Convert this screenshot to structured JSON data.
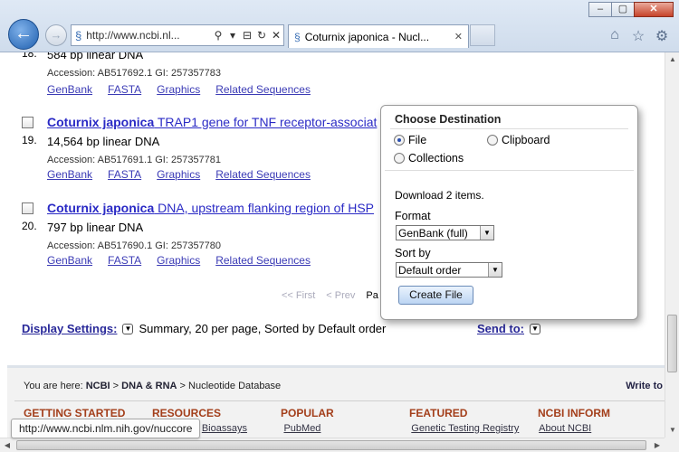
{
  "window": {
    "min": "‒",
    "max": "▢",
    "close": "✕"
  },
  "nav": {
    "back_icon": "arrow-left-icon",
    "forward_icon": "arrow-right-icon"
  },
  "address": {
    "url": "http://www.ncbi.nl...",
    "search_tool": "⚲",
    "dropdown": "▾",
    "compat": "⊟",
    "refresh": "↻",
    "stop": "✕"
  },
  "tab": {
    "title": "Coturnix japonica - Nucl...",
    "close": "✕"
  },
  "toolbar_icons": {
    "home": "⌂",
    "favorites": "☆",
    "tools": "⚙"
  },
  "results": [
    {
      "num": "18.",
      "title_bold": "",
      "title_rest": "",
      "size": "584 bp linear DNA",
      "accession": "Accession: AB517692.1   GI: 257357783",
      "links": [
        "GenBank",
        "FASTA",
        "Graphics",
        "Related Sequences"
      ]
    },
    {
      "num": "19.",
      "title_bold": "Coturnix japonica",
      "title_rest": " TRAP1 gene for TNF receptor-associat",
      "size": "14,564 bp linear DNA",
      "accession": "Accession: AB517691.1   GI: 257357781",
      "links": [
        "GenBank",
        "FASTA",
        "Graphics",
        "Related Sequences"
      ]
    },
    {
      "num": "20.",
      "title_bold": "Coturnix japonica",
      "title_rest": " DNA, upstream flanking region of HSP",
      "size": "797 bp linear DNA",
      "accession": "Accession: AB517690.1   GI: 257357780",
      "links": [
        "GenBank",
        "FASTA",
        "Graphics",
        "Related Sequences"
      ]
    }
  ],
  "pager": {
    "first": "<< First",
    "prev": "< Prev",
    "page": "Pa"
  },
  "display": {
    "label": "Display Settings:",
    "summary": "Summary, 20 per page, Sorted by Default order",
    "send_to": "Send to:"
  },
  "footer": {
    "you_are_here": "You are here:",
    "crumb": [
      "NCBI",
      "DNA & RNA"
    ],
    "crumb_current": "Nucleotide Database",
    "sep": ">",
    "write_to": "Write to",
    "heads": [
      "GETTING STARTED",
      "RESOURCES",
      "POPULAR",
      "FEATURED",
      "NCBI INFORM"
    ],
    "subs": [
      "",
      "Bioassays",
      "PubMed",
      "Genetic Testing Registry",
      "About NCBI"
    ]
  },
  "popup": {
    "title": "Choose Destination",
    "options": [
      "File",
      "Clipboard",
      "Collections"
    ],
    "selected": "File",
    "download_text": "Download 2 items.",
    "format_label": "Format",
    "format_value": "GenBank (full)",
    "sort_label": "Sort by",
    "sort_value": "Default order",
    "create_button": "Create File"
  },
  "status_url": "http://www.ncbi.nlm.nih.gov/nuccore"
}
